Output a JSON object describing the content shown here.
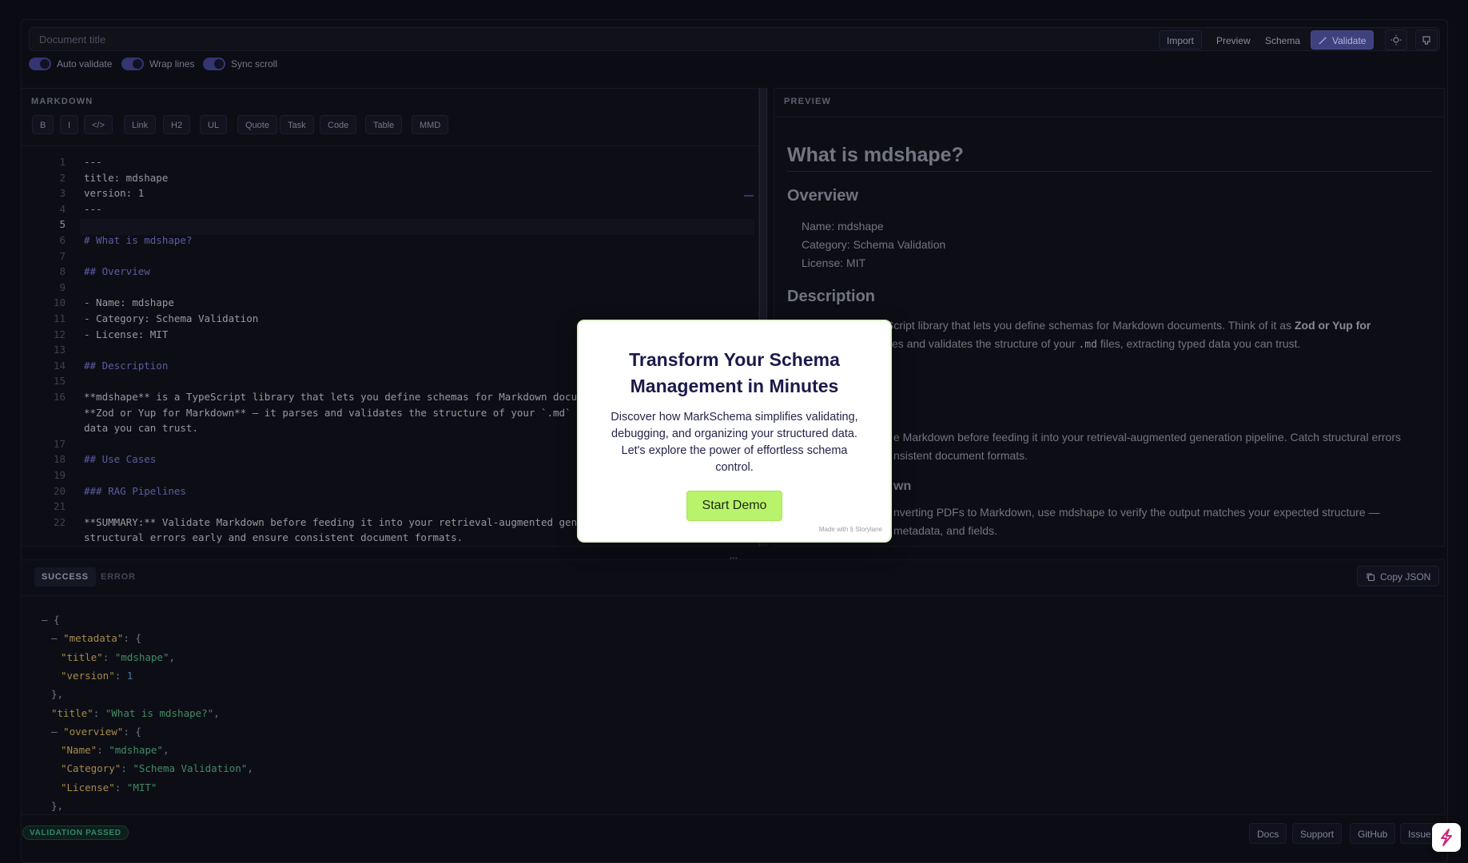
{
  "header": {
    "title_placeholder": "Document title",
    "import_label": "Import",
    "preview_label": "Preview",
    "schema_label": "Schema",
    "validate_label": "Validate"
  },
  "toggles": [
    {
      "label": "Auto validate",
      "on": true
    },
    {
      "label": "Wrap lines",
      "on": true
    },
    {
      "label": "Sync scroll",
      "on": true
    }
  ],
  "editor": {
    "title": "MARKDOWN",
    "format_buttons": [
      "B",
      "I",
      "</>",
      "Link",
      "H2",
      "UL",
      "Quote",
      "Task",
      "Code",
      "Table",
      "MMD"
    ],
    "active_line": 5,
    "lines": [
      {
        "n": "1",
        "text": "---"
      },
      {
        "n": "2",
        "text": "title: mdshape"
      },
      {
        "n": "3",
        "text": "version: 1"
      },
      {
        "n": "4",
        "text": "---"
      },
      {
        "n": "5",
        "text": ""
      },
      {
        "n": "6",
        "text": "# What is mdshape?"
      },
      {
        "n": "7",
        "text": ""
      },
      {
        "n": "8",
        "text": "## Overview"
      },
      {
        "n": "9",
        "text": ""
      },
      {
        "n": "10",
        "text": "- Name: mdshape"
      },
      {
        "n": "11",
        "text": "- Category: Schema Validation"
      },
      {
        "n": "12",
        "text": "- License: MIT"
      },
      {
        "n": "13",
        "text": ""
      },
      {
        "n": "14",
        "text": "## Description"
      },
      {
        "n": "15",
        "text": ""
      },
      {
        "n": "16",
        "text": "**mdshape** is a TypeScript library that lets you define schemas for Markdown docume"
      },
      {
        "n": "",
        "text": "**Zod or Yup for Markdown** — it parses and validates the structure of your `.md` f"
      },
      {
        "n": "",
        "text": "data you can trust."
      },
      {
        "n": "17",
        "text": ""
      },
      {
        "n": "18",
        "text": "## Use Cases"
      },
      {
        "n": "19",
        "text": ""
      },
      {
        "n": "20",
        "text": "### RAG Pipelines"
      },
      {
        "n": "21",
        "text": ""
      },
      {
        "n": "22",
        "text": "**SUMMARY:** Validate Markdown before feeding it into your retrieval-augmented gene"
      },
      {
        "n": "",
        "text": "structural errors early and ensure consistent document formats."
      }
    ]
  },
  "preview": {
    "title": "PREVIEW",
    "h1": "What is mdshape?",
    "overview_heading": "Overview",
    "overview_items": [
      "Name: mdshape",
      "Category: Schema Validation",
      "License: MIT"
    ],
    "description_heading": "Description",
    "description_line1": "Script library that lets you define schemas for Markdown documents. Think of it as",
    "description_bold": "Zod or Yup for",
    "description_line2_pre": "ses and validates the structure of your",
    "description_code": ".md",
    "description_line2_post": "files, extracting typed data you can trust.",
    "rag_line1": "e Markdown before feeding it into your retrieval-augmented generation pipeline. Catch structural errors",
    "rag_line2": "nsistent document formats.",
    "pdf_heading_fragment": "wn",
    "pdf_line1": "nverting PDFs to Markdown, use mdshape to verify the output matches your expected structure —",
    "pdf_line2": "metadata, and fields."
  },
  "result": {
    "tab_success": "SUCCESS",
    "tab_error": "ERROR",
    "copy_label": "Copy JSON",
    "json_lines": [
      {
        "indent": 0,
        "parts": [
          [
            "m",
            "– {"
          ]
        ]
      },
      {
        "indent": 1,
        "parts": [
          [
            "m",
            "– "
          ],
          [
            "k",
            "\"metadata\""
          ],
          [
            "m",
            ": {"
          ]
        ]
      },
      {
        "indent": 2,
        "parts": [
          [
            "k",
            "\"title\""
          ],
          [
            "m",
            ": "
          ],
          [
            "s",
            "\"mdshape\""
          ],
          [
            "m",
            ","
          ]
        ]
      },
      {
        "indent": 2,
        "parts": [
          [
            "k",
            "\"version\""
          ],
          [
            "m",
            ": "
          ],
          [
            "n",
            "1"
          ]
        ]
      },
      {
        "indent": 1,
        "parts": [
          [
            "m",
            "},"
          ]
        ]
      },
      {
        "indent": 1,
        "parts": [
          [
            "k",
            "\"title\""
          ],
          [
            "m",
            ": "
          ],
          [
            "s",
            "\"What is mdshape?\""
          ],
          [
            "m",
            ","
          ]
        ]
      },
      {
        "indent": 1,
        "parts": [
          [
            "m",
            "– "
          ],
          [
            "k",
            "\"overview\""
          ],
          [
            "m",
            ": {"
          ]
        ]
      },
      {
        "indent": 2,
        "parts": [
          [
            "k",
            "\"Name\""
          ],
          [
            "m",
            ": "
          ],
          [
            "s",
            "\"mdshape\""
          ],
          [
            "m",
            ","
          ]
        ]
      },
      {
        "indent": 2,
        "parts": [
          [
            "k",
            "\"Category\""
          ],
          [
            "m",
            ": "
          ],
          [
            "s",
            "\"Schema Validation\""
          ],
          [
            "m",
            ","
          ]
        ]
      },
      {
        "indent": 2,
        "parts": [
          [
            "k",
            "\"License\""
          ],
          [
            "m",
            ": "
          ],
          [
            "s",
            "\"MIT\""
          ]
        ]
      },
      {
        "indent": 1,
        "parts": [
          [
            "m",
            "},"
          ]
        ]
      }
    ]
  },
  "footer": {
    "status_badge": "VALIDATION PASSED",
    "links": [
      "Docs",
      "Support",
      "GitHub",
      "Issue"
    ]
  },
  "modal": {
    "title": "Transform Your Schema Management in Minutes",
    "body": "Discover how MarkSchema simplifies validating, debugging, and organizing your structured data. Let's explore the power of effortless schema control.",
    "cta_label": "Start Demo",
    "credit": "Made with § Storylane"
  },
  "colors": {
    "accent": "#4c4f99",
    "success": "#3aa57a",
    "cta": "#b9f36b",
    "modal_title": "#1b1a4a"
  },
  "icons": [
    "magic-wand-icon",
    "sun-icon",
    "github-icon",
    "copy-icon",
    "storylane-icon",
    "grip-icon"
  ]
}
